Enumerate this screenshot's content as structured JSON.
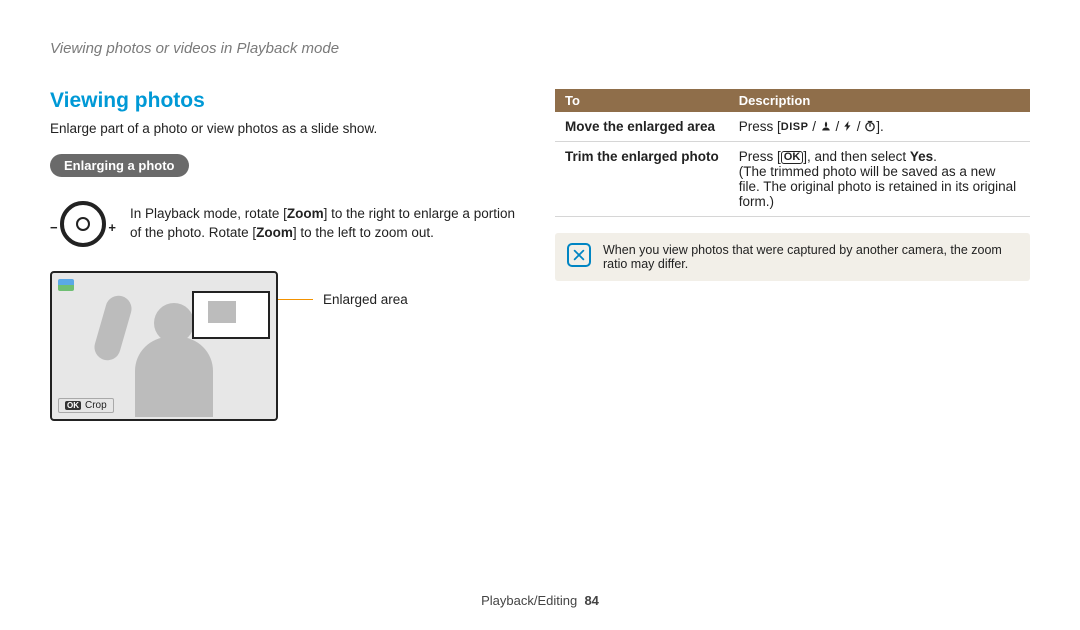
{
  "breadcrumb": "Viewing photos or videos in Playback mode",
  "section": {
    "title": "Viewing photos",
    "intro": "Enlarge part of a photo or view photos as a slide show.",
    "pill": "Enlarging a photo",
    "dial_text_1": "In Playback mode, rotate [",
    "dial_zoom1": "Zoom",
    "dial_text_2": "] to the right to enlarge a portion of the photo. Rotate [",
    "dial_zoom2": "Zoom",
    "dial_text_3": "] to the left to zoom out.",
    "crop_label": "Crop",
    "enlarged_label": "Enlarged area"
  },
  "table": {
    "head_to": "To",
    "head_desc": "Description",
    "rows": [
      {
        "action": "Move the enlarged area",
        "desc_pre": "Press [",
        "desc_post": "]."
      },
      {
        "action": "Trim the enlarged photo",
        "desc_pre": "Press [",
        "desc_mid": "], and then select ",
        "desc_yes": "Yes",
        "desc_post": ".",
        "desc_note": "(The trimmed photo will be saved as a new file. The original photo is retained in its original form.)"
      }
    ]
  },
  "note": "When you view photos that were captured by another camera, the zoom ratio may differ.",
  "footer": {
    "section": "Playback/Editing",
    "page": "84"
  }
}
